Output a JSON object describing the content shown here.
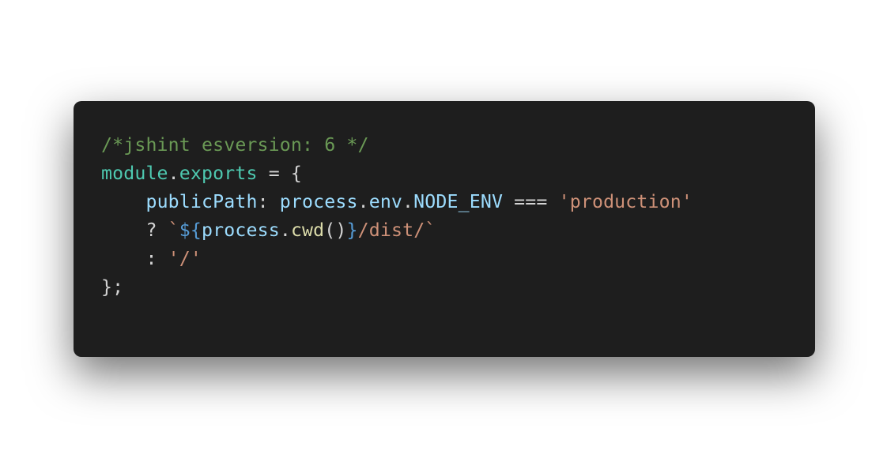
{
  "code": {
    "lines": [
      [
        {
          "text": "/*jshint esversion: 6 */",
          "kind": "comment"
        }
      ],
      [
        {
          "text": "module",
          "kind": "module"
        },
        {
          "text": ".",
          "kind": "punct"
        },
        {
          "text": "exports",
          "kind": "module"
        },
        {
          "text": " = {",
          "kind": "punct"
        }
      ],
      [
        {
          "text": "    ",
          "kind": "punct"
        },
        {
          "text": "publicPath",
          "kind": "prop"
        },
        {
          "text": ": ",
          "kind": "punct"
        },
        {
          "text": "process",
          "kind": "prop"
        },
        {
          "text": ".",
          "kind": "punct"
        },
        {
          "text": "env",
          "kind": "prop"
        },
        {
          "text": ".",
          "kind": "punct"
        },
        {
          "text": "NODE_ENV",
          "kind": "prop"
        },
        {
          "text": " === ",
          "kind": "punct"
        },
        {
          "text": "'production'",
          "kind": "string"
        }
      ],
      [
        {
          "text": "    ? ",
          "kind": "punct"
        },
        {
          "text": "`",
          "kind": "string"
        },
        {
          "text": "${",
          "kind": "interp"
        },
        {
          "text": "process",
          "kind": "prop"
        },
        {
          "text": ".",
          "kind": "punct"
        },
        {
          "text": "cwd",
          "kind": "func"
        },
        {
          "text": "()",
          "kind": "punct"
        },
        {
          "text": "}",
          "kind": "interp"
        },
        {
          "text": "/dist/`",
          "kind": "string"
        }
      ],
      [
        {
          "text": "    : ",
          "kind": "punct"
        },
        {
          "text": "'/'",
          "kind": "string"
        }
      ],
      [
        {
          "text": "};",
          "kind": "punct"
        }
      ]
    ]
  },
  "colors": {
    "background": "#1e1e1e",
    "comment": "#6a9955",
    "module": "#4ec9b0",
    "prop": "#9cdcfe",
    "punct": "#d4d4d4",
    "string": "#ce9178",
    "interp": "#569cd6",
    "func": "#dcdcaa"
  }
}
